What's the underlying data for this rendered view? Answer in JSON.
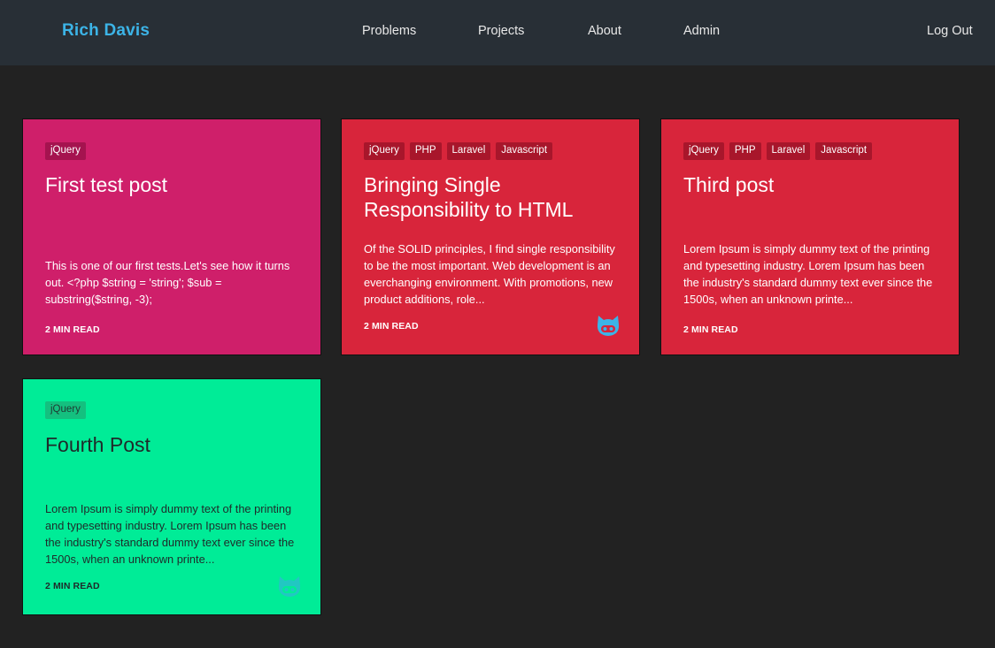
{
  "nav": {
    "brand": "Rich Davis",
    "links": [
      "Problems",
      "Projects",
      "About",
      "Admin"
    ],
    "logout": "Log Out"
  },
  "colors": {
    "navbar": "#282f36",
    "brand": "#3cb4e7",
    "background": "#222222",
    "pink": "#cf1f6a",
    "red": "#d8253b",
    "green": "#00ec97"
  },
  "posts": [
    {
      "tags": [
        "jQuery"
      ],
      "title": "First test post",
      "excerpt": "This is one of our first tests.Let's see how it turns out.   <?php  $string = 'string'; $sub = substring($string, -3);",
      "read_time": "2 MIN READ",
      "github_icon": false
    },
    {
      "tags": [
        "jQuery",
        "PHP",
        "Laravel",
        "Javascript"
      ],
      "title": "Bringing Single Responsibility to HTML",
      "excerpt": "Of the SOLID principles, I find single responsibility to be the most important.  Web development is an everchanging environment.  With promotions, new product additions, role...",
      "read_time": "2 MIN READ",
      "github_icon": true
    },
    {
      "tags": [
        "jQuery",
        "PHP",
        "Laravel",
        "Javascript"
      ],
      "title": "Third post",
      "excerpt": "Lorem Ipsum is simply dummy text of the printing and typesetting industry. Lorem Ipsum has been the industry's standard dummy text ever since the 1500s, when an unknown printe...",
      "read_time": "2 MIN READ",
      "github_icon": false
    },
    {
      "tags": [
        "jQuery"
      ],
      "title": "Fourth Post",
      "excerpt": "Lorem Ipsum is simply dummy text of the printing and typesetting industry. Lorem Ipsum has been the industry's standard dummy text ever since the 1500s, when an unknown printe...",
      "read_time": "2 MIN READ",
      "github_icon": true
    }
  ]
}
